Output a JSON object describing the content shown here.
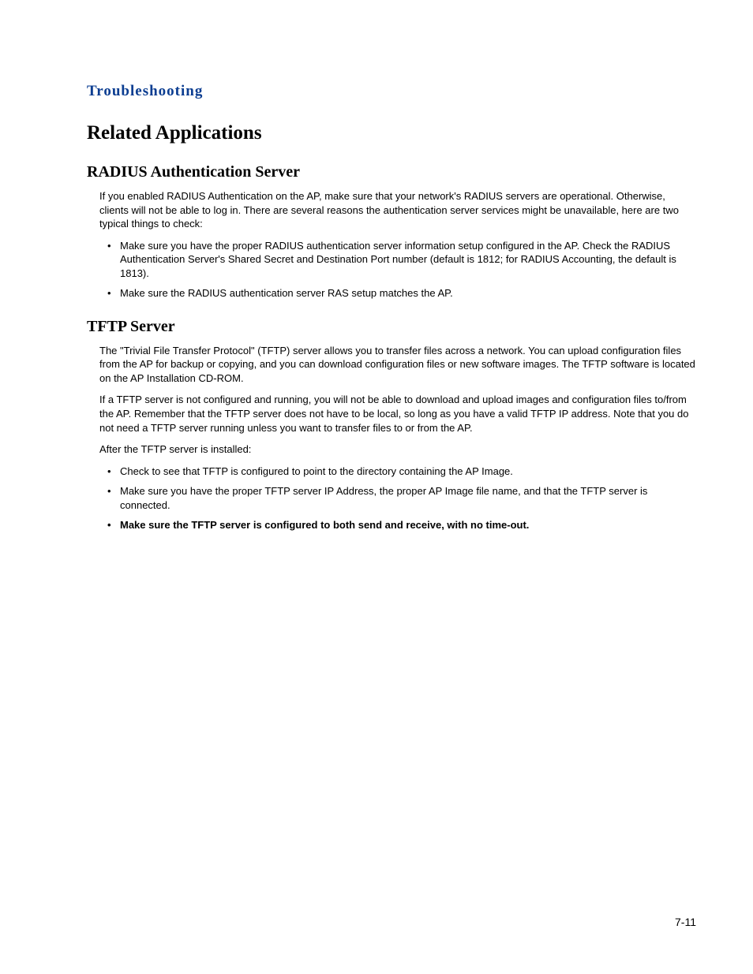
{
  "chapter_title": "Troubleshooting",
  "heading1": "Related Applications",
  "section1": {
    "heading": "RADIUS Authentication Server",
    "para1": "If you enabled RADIUS Authentication on the AP, make sure that your network's RADIUS servers are operational. Otherwise, clients will not be able to log in. There are several reasons the authentication server services might be unavailable, here are two typical things to check:",
    "bullets": [
      "Make sure you have the proper RADIUS authentication server information setup configured in the AP. Check the RADIUS Authentication Server's Shared Secret and Destination Port number (default is 1812; for RADIUS Accounting, the default is 1813).",
      "Make sure the RADIUS authentication server RAS setup matches the AP."
    ]
  },
  "section2": {
    "heading": "TFTP Server",
    "para1": "The \"Trivial File Transfer Protocol\" (TFTP) server allows you to transfer files across a network. You can upload configuration files from the AP for backup or copying, and you can download configuration files or new software images. The TFTP software is located on the AP Installation CD-ROM.",
    "para2": "If a TFTP server is not configured and running, you will not be able to download and upload images and configuration files to/from the AP. Remember that the TFTP server does not have to be local, so long as you have a valid TFTP IP address. Note that you do not need a TFTP server running unless you want to transfer files to or from the AP.",
    "para3": "After the TFTP server is installed:",
    "bullets": [
      "Check to see that TFTP is configured to point to the directory containing the AP Image.",
      "Make sure you have the proper TFTP server IP Address, the proper AP Image file name, and that the TFTP server is connected."
    ],
    "bullet_bold": "Make sure the TFTP server is configured to both send and receive, with no time-out."
  },
  "page_number": "7-11"
}
